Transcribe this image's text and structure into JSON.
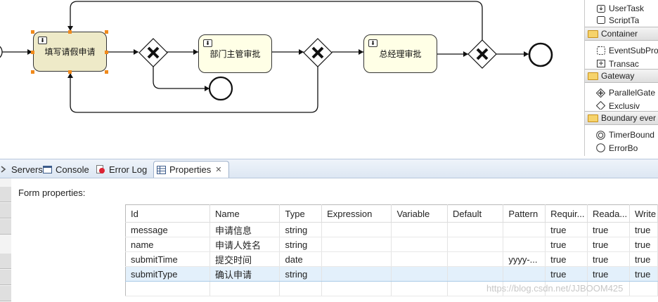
{
  "diagram": {
    "tasks": [
      {
        "label": "填写请假申请"
      },
      {
        "label": "部门主管审批"
      },
      {
        "label": "总经理审批"
      }
    ]
  },
  "palette": {
    "items": [
      {
        "label": "UserTask",
        "icon": "user-task-icon"
      },
      {
        "label": "ScriptTa",
        "icon": "script-task-icon"
      },
      {
        "label": "Container",
        "icon": "folder-icon",
        "drawer": true
      },
      {
        "label": "EventSubPro",
        "icon": "event-subprocess-icon"
      },
      {
        "label": "Transac",
        "icon": "transaction-icon"
      },
      {
        "label": "Gateway",
        "icon": "folder-icon",
        "drawer": true
      },
      {
        "label": "ParallelGate",
        "icon": "parallel-gateway-icon"
      },
      {
        "label": "Exclusiv",
        "icon": "exclusive-gateway-icon"
      },
      {
        "label": "Boundary ever",
        "icon": "folder-icon",
        "drawer": true
      },
      {
        "label": "TimerBound",
        "icon": "timer-boundary-icon"
      },
      {
        "label": "ErrorBo",
        "icon": "error-boundary-icon"
      }
    ]
  },
  "tabs": [
    {
      "label": "Servers",
      "icon": "servers-icon"
    },
    {
      "label": "Console",
      "icon": "console-icon"
    },
    {
      "label": "Error Log",
      "icon": "error-log-icon"
    },
    {
      "label": "Properties",
      "icon": "properties-icon",
      "active": true
    }
  ],
  "properties": {
    "form_label": "Form properties:",
    "columns": [
      "Id",
      "Name",
      "Type",
      "Expression",
      "Variable",
      "Default",
      "Pattern",
      "Requir...",
      "Reada...",
      "Write"
    ],
    "rows": [
      [
        "message",
        "申请信息",
        "string",
        "",
        "",
        "",
        "",
        "true",
        "true",
        "true"
      ],
      [
        "name",
        "申请人姓名",
        "string",
        "",
        "",
        "",
        "",
        "true",
        "true",
        "true"
      ],
      [
        "submitTime",
        "提交时间",
        "date",
        "",
        "",
        "",
        "yyyy-...",
        "true",
        "true",
        "true"
      ],
      [
        "submitType",
        "确认申请",
        "string",
        "",
        "",
        "",
        "",
        "true",
        "true",
        "true"
      ],
      [
        "",
        "",
        "",
        "",
        "",
        "",
        "",
        "",
        "",
        ""
      ]
    ],
    "selected_row": 3
  },
  "watermark": "https://blog.csdn.net/JJBOOM425",
  "colors": {
    "handle": "#f08a1c",
    "task_fill": "#ffffe6",
    "task_selected_fill": "#eeeac8",
    "selected_row": "#e3f0fb"
  }
}
